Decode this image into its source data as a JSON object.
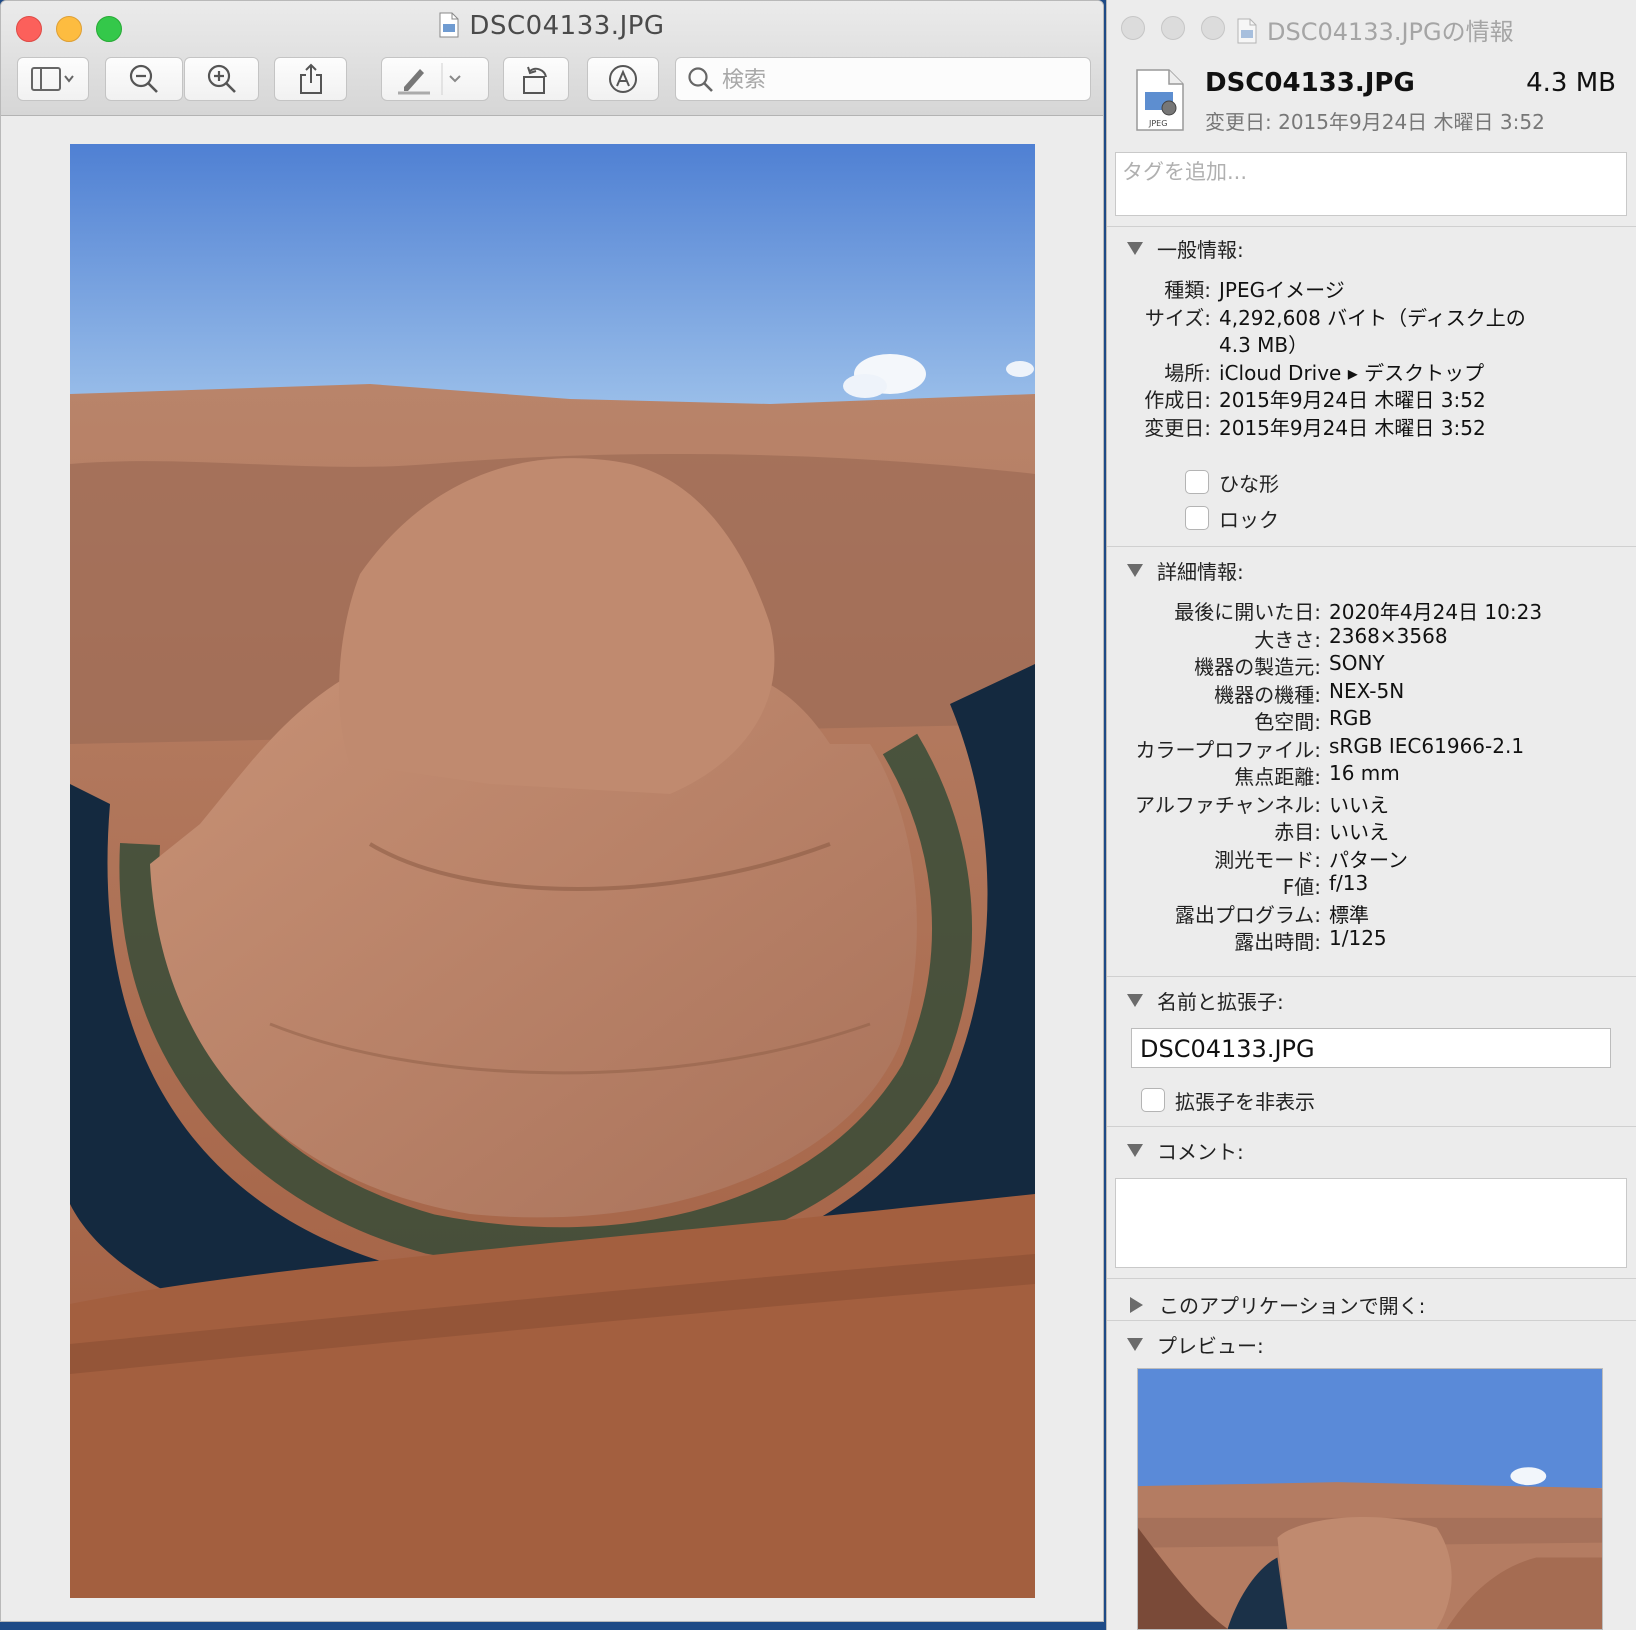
{
  "preview": {
    "title": "DSC04133.JPG",
    "search": {
      "placeholder": "検索"
    },
    "icons": [
      "sidebar-icon",
      "zoom-out-icon",
      "zoom-in-icon",
      "share-icon",
      "markup-pen-icon",
      "rotate-icon",
      "annotate-icon",
      "search-icon"
    ]
  },
  "info": {
    "window_title": "DSC04133.JPGの情報",
    "file_name": "DSC04133.JPG",
    "file_size": "4.3 MB",
    "modified": "変更日: 2015年9月24日 木曜日 3:52",
    "tags_placeholder": "タグを追加...",
    "general": {
      "heading": "一般情報:",
      "rows": [
        {
          "k": "種類:",
          "v": "JPEGイメージ"
        },
        {
          "k": "サイズ:",
          "v": "4,292,608 バイト（ディスク上の"
        },
        {
          "k": "",
          "v": "4.3 MB）"
        },
        {
          "k": "場所:",
          "v": "iCloud Drive ▸ デスクトップ"
        },
        {
          "k": "作成日:",
          "v": "2015年9月24日 木曜日 3:52"
        },
        {
          "k": "変更日:",
          "v": "2015年9月24日 木曜日 3:52"
        }
      ],
      "stationery": "ひな形",
      "locked": "ロック"
    },
    "more": {
      "heading": "詳細情報:",
      "rows": [
        {
          "k": "最後に開いた日:",
          "v": "2020年4月24日 10:23"
        },
        {
          "k": "大きさ:",
          "v": "2368×3568"
        },
        {
          "k": "機器の製造元:",
          "v": "SONY"
        },
        {
          "k": "機器の機種:",
          "v": "NEX-5N"
        },
        {
          "k": "色空間:",
          "v": "RGB"
        },
        {
          "k": "カラープロファイル:",
          "v": "sRGB IEC61966-2.1"
        },
        {
          "k": "焦点距離:",
          "v": "16 mm"
        },
        {
          "k": "アルファチャンネル:",
          "v": "いいえ"
        },
        {
          "k": "赤目:",
          "v": "いいえ"
        },
        {
          "k": "測光モード:",
          "v": "パターン"
        },
        {
          "k": "F値:",
          "v": "f/13"
        },
        {
          "k": "露出プログラム:",
          "v": "標準"
        },
        {
          "k": "露出時間:",
          "v": "1/125"
        }
      ]
    },
    "name_ext": {
      "heading": "名前と拡張子:",
      "value": "DSC04133.JPG",
      "hide_ext": "拡張子を非表示"
    },
    "comments": {
      "heading": "コメント:"
    },
    "open_with": {
      "heading": "このアプリケーションで開く:"
    },
    "preview_section": {
      "heading": "プレビュー:"
    }
  }
}
